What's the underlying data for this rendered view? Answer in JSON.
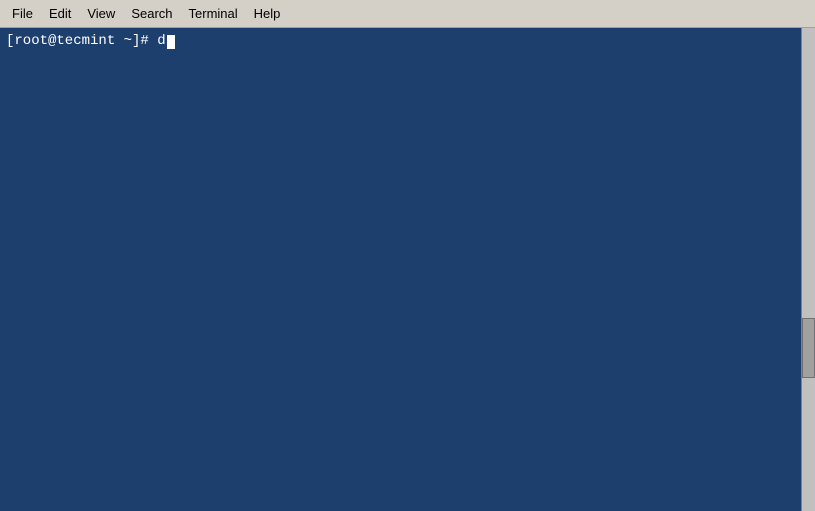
{
  "menubar": {
    "items": [
      {
        "id": "file",
        "label": "File"
      },
      {
        "id": "edit",
        "label": "Edit"
      },
      {
        "id": "view",
        "label": "View"
      },
      {
        "id": "search",
        "label": "Search"
      },
      {
        "id": "terminal",
        "label": "Terminal"
      },
      {
        "id": "help",
        "label": "Help"
      }
    ]
  },
  "terminal": {
    "prompt": "[root@tecmint ~]# d",
    "background_color": "#1c3f6e"
  }
}
